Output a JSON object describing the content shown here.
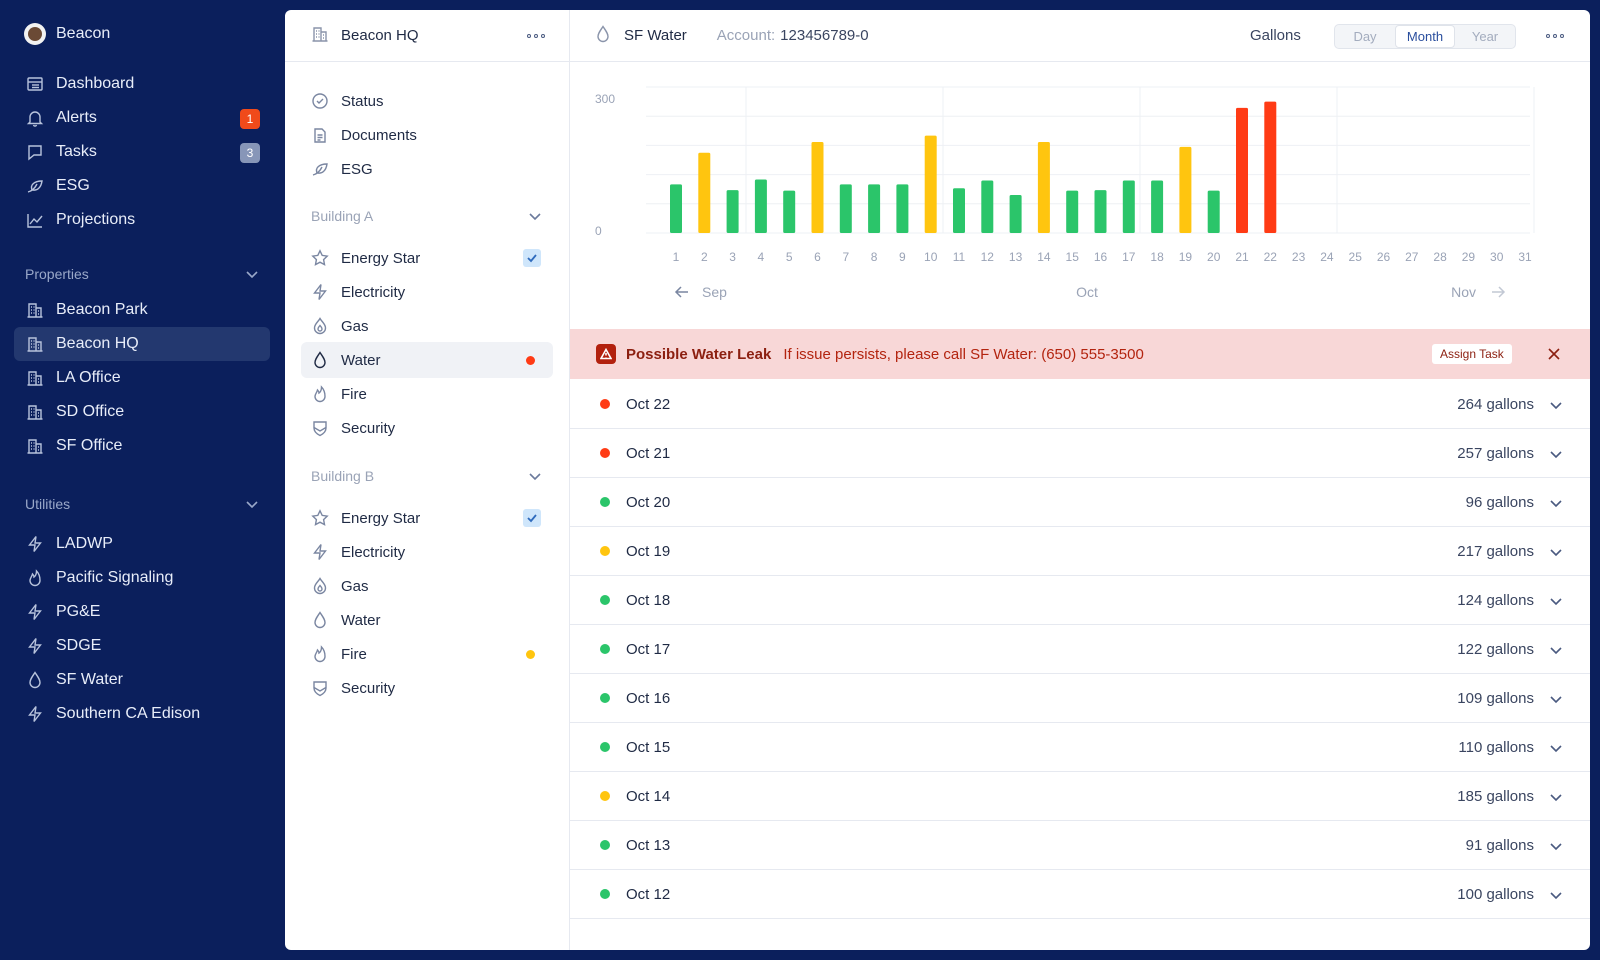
{
  "brand": {
    "name": "Beacon"
  },
  "nav": {
    "items": [
      {
        "label": "Dashboard",
        "icon": "dashboard-icon"
      },
      {
        "label": "Alerts",
        "icon": "bell-icon",
        "badge": "1"
      },
      {
        "label": "Tasks",
        "icon": "tasks-icon",
        "badge": "3"
      },
      {
        "label": "ESG",
        "icon": "leaf-icon"
      },
      {
        "label": "Projections",
        "icon": "trend-icon"
      }
    ],
    "properties_label": "Properties",
    "properties": [
      "Beacon Park",
      "Beacon HQ",
      "LA Office",
      "SD Office",
      "SF Office"
    ],
    "utilities_label": "Utilities",
    "utilities": [
      "LADWP",
      "Pacific Signaling",
      "PG&E",
      "SDGE",
      "SF Water",
      "Southern CA Edison"
    ]
  },
  "middle": {
    "title": "Beacon HQ",
    "top_items": [
      "Status",
      "Documents",
      "ESG"
    ],
    "building_a": {
      "label": "Building A",
      "items": [
        "Energy Star",
        "Electricity",
        "Gas",
        "Water",
        "Fire",
        "Security"
      ]
    },
    "building_b": {
      "label": "Building B",
      "items": [
        "Energy Star",
        "Electricity",
        "Gas",
        "Water",
        "Fire",
        "Security"
      ]
    }
  },
  "main": {
    "utility": "SF Water",
    "account_label": "Account:",
    "account_value": "123456789-0",
    "unit": "Gallons",
    "periods": [
      "Day",
      "Month",
      "Year"
    ],
    "selected_period": "Month"
  },
  "chart_data": {
    "type": "bar",
    "ylim": [
      0,
      300
    ],
    "yticks": [
      "300",
      "0"
    ],
    "categories": [
      "1",
      "2",
      "3",
      "4",
      "5",
      "6",
      "7",
      "8",
      "9",
      "10",
      "11",
      "12",
      "13",
      "14",
      "15",
      "16",
      "17",
      "18",
      "19",
      "20",
      "21",
      "22",
      "23",
      "24",
      "25",
      "26",
      "27",
      "28",
      "29",
      "30",
      "31"
    ],
    "values": [
      100,
      165,
      88,
      110,
      87,
      187,
      100,
      100,
      100,
      200,
      92,
      108,
      78,
      187,
      87,
      88,
      108,
      108,
      177,
      87,
      257,
      270,
      null,
      null,
      null,
      null,
      null,
      null,
      null,
      null,
      null
    ],
    "bar_colors": [
      "#2bc56a",
      "#ffc50f",
      "#2bc56a",
      "#2bc56a",
      "#2bc56a",
      "#ffc50f",
      "#2bc56a",
      "#2bc56a",
      "#2bc56a",
      "#ffc50f",
      "#2bc56a",
      "#2bc56a",
      "#2bc56a",
      "#ffc50f",
      "#2bc56a",
      "#2bc56a",
      "#2bc56a",
      "#2bc56a",
      "#ffc50f",
      "#2bc56a",
      "#ff3b15",
      "#ff3b15"
    ],
    "nav": {
      "prev": "Sep",
      "current": "Oct",
      "next": "Nov"
    }
  },
  "alert": {
    "title": "Possible Water Leak",
    "message": "If issue persists, please call SF Water: (650) 555-3500",
    "action": "Assign Task"
  },
  "readings": [
    {
      "date": "Oct 22",
      "value": "264 gallons",
      "status": "#ff3b15"
    },
    {
      "date": "Oct 21",
      "value": "257 gallons",
      "status": "#ff3b15"
    },
    {
      "date": "Oct 20",
      "value": "96 gallons",
      "status": "#2bc56a"
    },
    {
      "date": "Oct 19",
      "value": "217 gallons",
      "status": "#ffc50f"
    },
    {
      "date": "Oct 18",
      "value": "124 gallons",
      "status": "#2bc56a"
    },
    {
      "date": "Oct 17",
      "value": "122 gallons",
      "status": "#2bc56a"
    },
    {
      "date": "Oct 16",
      "value": "109 gallons",
      "status": "#2bc56a"
    },
    {
      "date": "Oct 15",
      "value": "110 gallons",
      "status": "#2bc56a"
    },
    {
      "date": "Oct 14",
      "value": "185 gallons",
      "status": "#ffc50f"
    },
    {
      "date": "Oct 13",
      "value": "91 gallons",
      "status": "#2bc56a"
    },
    {
      "date": "Oct 12",
      "value": "100 gallons",
      "status": "#2bc56a"
    }
  ]
}
